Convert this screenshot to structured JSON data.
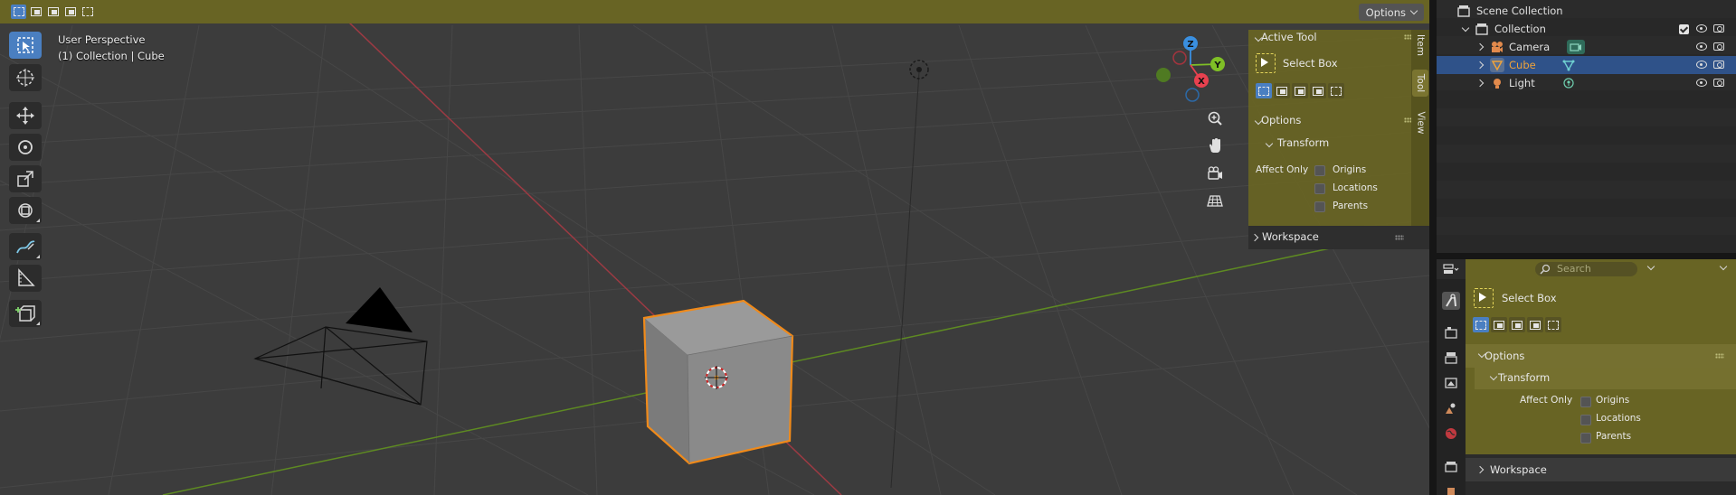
{
  "viewport": {
    "info_line1": "User Perspective",
    "info_line2": "(1) Collection | Cube",
    "options_label": "Options",
    "toolbar_tools": [
      "select-box",
      "cursor",
      "move",
      "rotate",
      "scale",
      "transform",
      "annotate",
      "measure",
      "add-cube"
    ],
    "gizmo": {
      "x": "X",
      "y": "Y",
      "z": "Z"
    }
  },
  "npanel": {
    "tabs": [
      "Item",
      "Tool",
      "View"
    ],
    "active_tab": "Tool",
    "active_tool_header": "Active Tool",
    "tool_name": "Select Box",
    "options_header": "Options",
    "transform_header": "Transform",
    "affect_only_label": "Affect Only",
    "checks": [
      "Origins",
      "Locations",
      "Parents"
    ],
    "workspace_header": "Workspace"
  },
  "outliner": {
    "root": "Scene Collection",
    "collection": "Collection",
    "items": [
      {
        "name": "Camera",
        "selected": false
      },
      {
        "name": "Cube",
        "selected": true
      },
      {
        "name": "Light",
        "selected": false
      }
    ]
  },
  "properties": {
    "search_placeholder": "Search",
    "tool_name": "Select Box",
    "options_header": "Options",
    "transform_header": "Transform",
    "affect_only_label": "Affect Only",
    "checks": [
      "Origins",
      "Locations",
      "Parents"
    ],
    "workspace_header": "Workspace"
  },
  "colors": {
    "highlight": "#686424",
    "accent_blue": "#4a7fc1",
    "selection_orange": "#f0a33a",
    "axis_x": "#e8414f",
    "axis_y": "#7fbf26",
    "axis_z": "#3a8fe0"
  }
}
